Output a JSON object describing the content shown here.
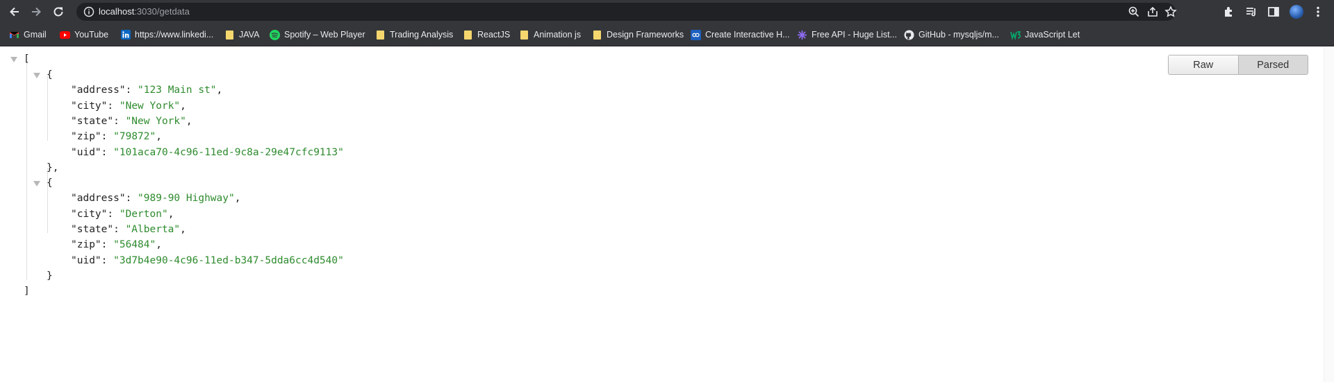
{
  "browser": {
    "url_host": "localhost",
    "url_path": ":3030/getdata",
    "icons": [
      "back-icon",
      "forward-icon",
      "reload-icon",
      "info-icon",
      "zoom-icon",
      "share-icon",
      "star-icon",
      "extensions-icon",
      "reading-list-icon",
      "side-panel-icon",
      "profile-avatar",
      "kebab-menu-icon"
    ]
  },
  "bookmarks": [
    {
      "label": "Gmail",
      "icon": "gmail-icon"
    },
    {
      "label": "YouTube",
      "icon": "youtube-icon"
    },
    {
      "label": "https://www.linkedi...",
      "icon": "linkedin-icon"
    },
    {
      "label": "JAVA",
      "icon": "folder-icon"
    },
    {
      "label": "Spotify – Web Player",
      "icon": "spotify-icon"
    },
    {
      "label": "Trading Analysis",
      "icon": "folder-icon"
    },
    {
      "label": "ReactJS",
      "icon": "folder-icon"
    },
    {
      "label": "Animation js",
      "icon": "folder-icon"
    },
    {
      "label": "Design Frameworks",
      "icon": "folder-icon"
    },
    {
      "label": "Create Interactive H...",
      "icon": "codepen-icon"
    },
    {
      "label": "Free API - Huge List...",
      "icon": "asterisk-icon"
    },
    {
      "label": "GitHub - mysqljs/m...",
      "icon": "github-icon"
    },
    {
      "label": "JavaScript Let",
      "icon": "w3-icon"
    }
  ],
  "viewer": {
    "raw_label": "Raw",
    "parsed_label": "Parsed",
    "open_bracket": "[",
    "close_bracket": "]",
    "open_brace": "{",
    "close_brace_comma": "},",
    "close_brace": "}",
    "records": [
      {
        "fields": [
          {
            "key": "\"address\"",
            "value": "\"123 Main st\"",
            "sep": ","
          },
          {
            "key": "\"city\"",
            "value": "\"New York\"",
            "sep": ","
          },
          {
            "key": "\"state\"",
            "value": "\"New York\"",
            "sep": ","
          },
          {
            "key": "\"zip\"",
            "value": "\"79872\"",
            "sep": ","
          },
          {
            "key": "\"uid\"",
            "value": "\"101aca70-4c96-11ed-9c8a-29e47cfc9113\"",
            "sep": ""
          }
        ]
      },
      {
        "fields": [
          {
            "key": "\"address\"",
            "value": "\"989-90 Highway\"",
            "sep": ","
          },
          {
            "key": "\"city\"",
            "value": "\"Derton\"",
            "sep": ","
          },
          {
            "key": "\"state\"",
            "value": "\"Alberta\"",
            "sep": ","
          },
          {
            "key": "\"zip\"",
            "value": "\"56484\"",
            "sep": ","
          },
          {
            "key": "\"uid\"",
            "value": "\"3d7b4e90-4c96-11ed-b347-5dda6cc4d540\"",
            "sep": ""
          }
        ]
      }
    ]
  }
}
